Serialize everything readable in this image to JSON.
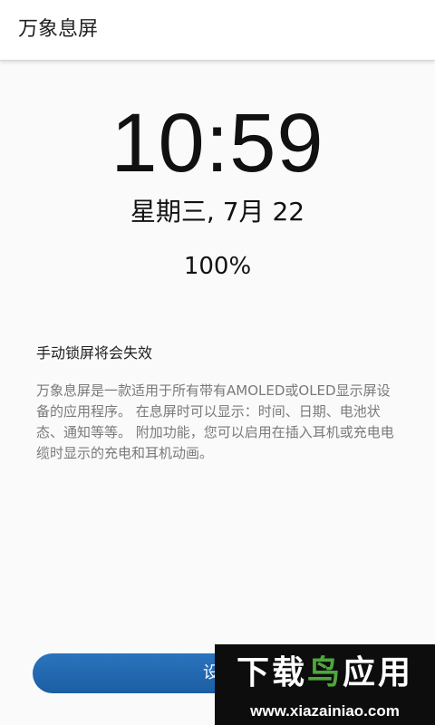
{
  "app_bar": {
    "title": "万象息屏"
  },
  "clock": {
    "time": "10:59",
    "date": "星期三, 7月 22",
    "battery": "100%"
  },
  "content": {
    "notice": "手动锁屏将会失效",
    "description": "万象息屏是一款适用于所有带有AMOLED或OLED显示屏设备的应用程序。 在息屏时可以显示：时间、日期、电池状态、通知等等。 附加功能，您可以启用在插入耳机或充电电缆时显示的充电和耳机动画。"
  },
  "primary_button": {
    "label": "设置",
    "color": "#1c5ea4"
  },
  "watermark": {
    "title_part1": "下载",
    "title_part2": "鸟",
    "title_part3": "应用",
    "url": "www.xiazainiao.com",
    "accent_color": "#4ea83b"
  }
}
